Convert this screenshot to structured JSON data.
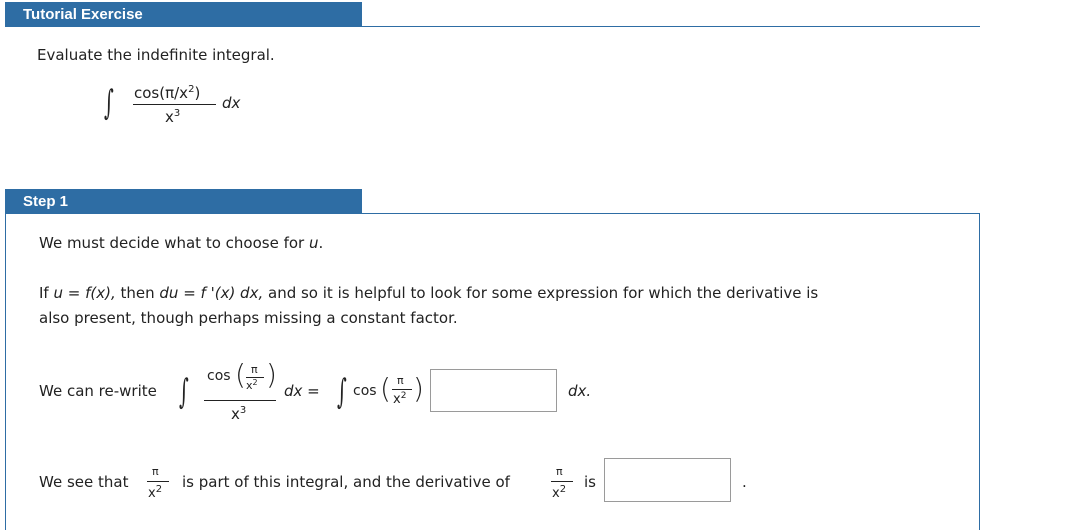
{
  "tutorial": {
    "title": "Tutorial Exercise",
    "prompt": "Evaluate the indefinite integral."
  },
  "integral": {
    "numerator": "cos(π/x",
    "num_sup": "2",
    "num_close": ")",
    "denominator": "x",
    "den_sup": "3",
    "dx": "dx"
  },
  "step1": {
    "title": "Step 1",
    "line1_a": "We must decide what to choose for ",
    "line1_u": "u",
    "line1_b": ".",
    "line2_a": "If ",
    "line2_eq": "u = f(x),",
    "line2_b": " then ",
    "line2_du": "du = f '(x) dx,",
    "line2_c": " and so it is helpful to look for some expression for which the derivative is",
    "line3": "also present, though perhaps missing a constant factor.",
    "rewrite_label": "We can re-write",
    "cos": "cos",
    "pi": "π",
    "x2": "x",
    "two": "2",
    "x3": "x",
    "three": "3",
    "dx_eq": "dx =",
    "dx_end": "dx.",
    "see_label": "We see that",
    "see_mid": "is part of this integral, and the derivative of",
    "see_is": "is",
    "see_end": "."
  }
}
